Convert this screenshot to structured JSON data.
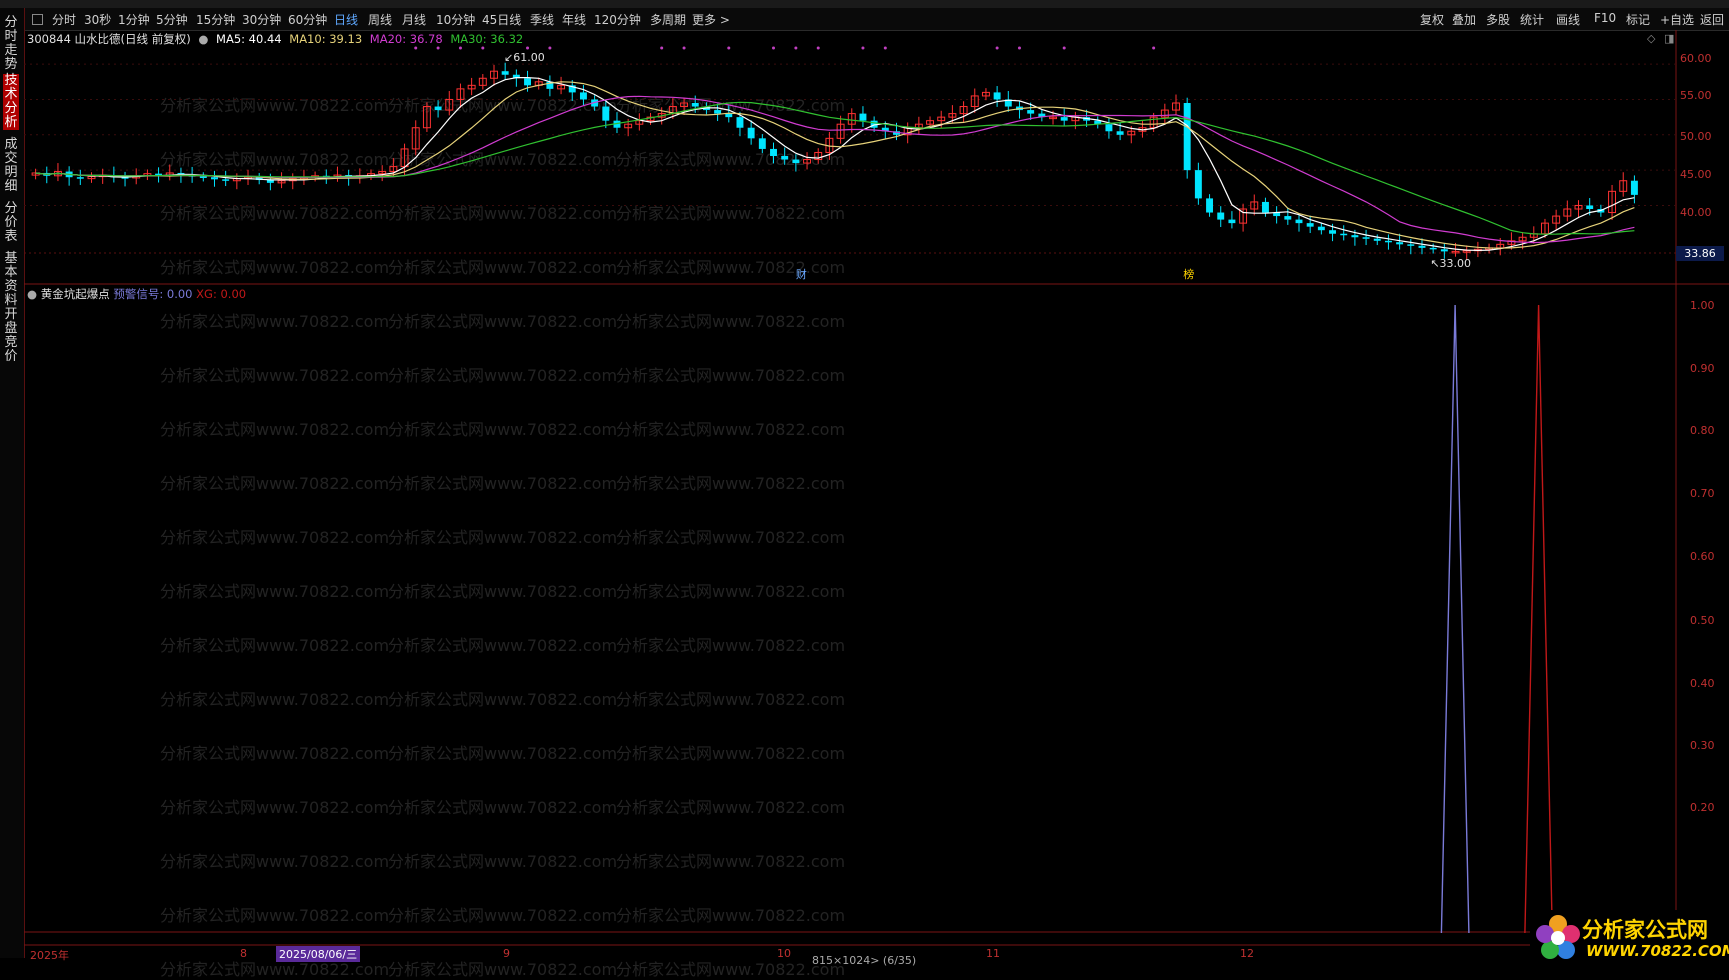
{
  "toolbar": {
    "periods": [
      "分时",
      "30秒",
      "1分钟",
      "5分钟",
      "15分钟",
      "30分钟",
      "60分钟",
      "日线",
      "周线",
      "月线",
      "10分钟",
      "45日线",
      "季线",
      "年线",
      "120分钟",
      "多周期",
      "更多 >"
    ],
    "active_period": "日线",
    "right_items": [
      "复权",
      "叠加",
      "多股",
      "统计",
      "画线",
      "F10",
      "标记",
      "+自选",
      "返回"
    ]
  },
  "sidebar": {
    "tabs": [
      {
        "label": "分时走势",
        "active": false
      },
      {
        "label": "技术分析",
        "active": true
      },
      {
        "label": "成交明细",
        "active": false
      },
      {
        "label": "分价表",
        "active": false
      },
      {
        "label": "基本资料",
        "active": false
      },
      {
        "label": "开盘竞价",
        "active": false
      }
    ]
  },
  "stock": {
    "code_name": "300844 山水比德(日线 前复权)",
    "ma5": "MA5: 40.44",
    "ma10": "MA10: 39.13",
    "ma20": "MA20: 36.78",
    "ma30": "MA30: 36.32",
    "high_marker": "61.00",
    "low_marker": "33.00",
    "current_price": "33.86",
    "event_cai": "财",
    "event_bang": "榜"
  },
  "indicator": {
    "name": "黄金坑起爆点",
    "signal_label": "预警信号: 0.00",
    "xg_label": "XG: 0.00"
  },
  "price_axis": [
    "60.00",
    "55.00",
    "50.00",
    "45.00",
    "40.00"
  ],
  "indicator_axis": [
    "1.00",
    "0.90",
    "0.80",
    "0.70",
    "0.60",
    "0.50",
    "0.40",
    "0.30",
    "0.20"
  ],
  "date_axis": {
    "labels": [
      "2025年",
      "8",
      "9",
      "10",
      "11",
      "12"
    ],
    "selected_date": "2025/08/06/三",
    "status": "815×1024> (6/35)"
  },
  "watermark": "分析家公式网www.70822.com",
  "logo": {
    "line1": "分析家公式网",
    "line2": "WWW.70822.COM"
  },
  "chart_data": [
    {
      "type": "candlestick",
      "title": "300844 山水比德(日线 前复权)",
      "ylim": [
        32,
        62
      ],
      "series_colors": {
        "up": "#ff3232",
        "down": "#00e5ff",
        "MA5": "#ffffff",
        "MA10": "#e6d27a",
        "MA20": "#d03cd0",
        "MA30": "#30c030"
      },
      "close": [
        44.6,
        44.2,
        44.8,
        44.0,
        43.8,
        44.1,
        44.3,
        44.0,
        43.9,
        44.2,
        44.5,
        44.3,
        44.6,
        44.4,
        44.1,
        44.0,
        43.7,
        43.5,
        43.8,
        44.0,
        43.6,
        43.2,
        43.5,
        43.8,
        44.0,
        44.2,
        44.1,
        44.3,
        44.0,
        44.2,
        44.5,
        44.8,
        45.5,
        48.0,
        51.0,
        54.0,
        53.5,
        55.0,
        56.5,
        57.0,
        58.0,
        59.0,
        58.5,
        58.0,
        57.0,
        57.5,
        56.5,
        57.0,
        56.0,
        55.0,
        54.0,
        52.0,
        51.0,
        51.5,
        52.0,
        52.5,
        53.0,
        54.0,
        54.5,
        54.0,
        53.5,
        53.0,
        52.5,
        51.0,
        49.5,
        48.0,
        47.0,
        46.5,
        46.0,
        46.5,
        47.5,
        49.5,
        51.5,
        53.0,
        52.0,
        51.0,
        50.5,
        50.0,
        51.0,
        51.5,
        52.0,
        52.5,
        53.0,
        54.0,
        55.5,
        56.0,
        55.0,
        54.0,
        53.5,
        53.0,
        52.5,
        52.5,
        52.0,
        52.5,
        52.0,
        51.5,
        50.5,
        50.0,
        50.5,
        51.0,
        52.5,
        53.5,
        54.5,
        45.0,
        41.0,
        39.0,
        38.0,
        37.5,
        39.5,
        40.5,
        39.0,
        38.5,
        38.0,
        37.5,
        37.0,
        36.5,
        36.0,
        35.8,
        35.5,
        35.3,
        35.0,
        34.8,
        34.5,
        34.3,
        34.0,
        33.8,
        33.5,
        33.5,
        33.6,
        33.8,
        34.0,
        34.5,
        35.0,
        35.5,
        36.0,
        37.5,
        38.5,
        39.5,
        40.0,
        39.5,
        39.0,
        42.0,
        43.5,
        41.5
      ]
    },
    {
      "type": "line",
      "title": "黄金坑起爆点",
      "ylim": [
        0,
        1
      ],
      "series": [
        {
          "name": "预警信号",
          "color": "#7a7ad8",
          "spike_index": 119,
          "value": 1.0
        },
        {
          "name": "XG",
          "color": "#c01818",
          "spike_index": 126,
          "value": 1.0
        }
      ],
      "n_points": 135
    }
  ]
}
